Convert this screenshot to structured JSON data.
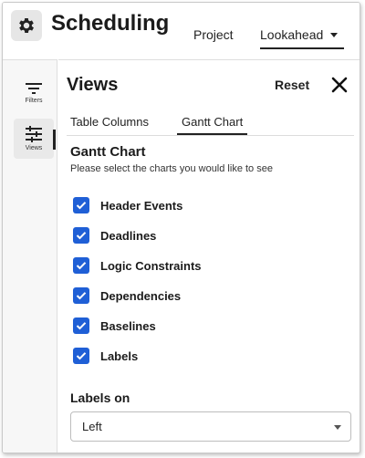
{
  "header": {
    "app_title": "Scheduling",
    "tabs": [
      {
        "label": "Project"
      },
      {
        "label": "Lookahead"
      }
    ]
  },
  "rail": {
    "items": [
      {
        "label": "Filters",
        "icon": "filter-icon"
      },
      {
        "label": "Views",
        "icon": "sliders-icon"
      }
    ]
  },
  "panel": {
    "title": "Views",
    "reset_label": "Reset",
    "tabs": [
      {
        "label": "Table Columns"
      },
      {
        "label": "Gantt Chart"
      }
    ],
    "section_title": "Gantt Chart",
    "section_subtitle": "Please select the charts you would like to see",
    "options": [
      {
        "label": "Header Events",
        "checked": true
      },
      {
        "label": "Deadlines",
        "checked": true
      },
      {
        "label": "Logic Constraints",
        "checked": true
      },
      {
        "label": "Dependencies",
        "checked": true
      },
      {
        "label": "Baselines",
        "checked": true
      },
      {
        "label": "Labels",
        "checked": true
      }
    ],
    "labels_on_title": "Labels on",
    "labels_on_value": "Left"
  },
  "colors": {
    "accent": "#1f5fd6",
    "text": "#1b1b1b"
  }
}
